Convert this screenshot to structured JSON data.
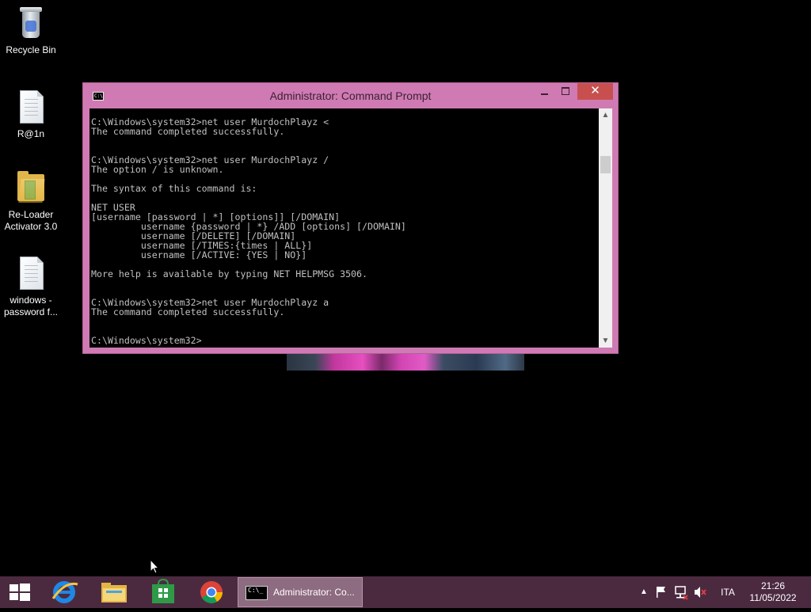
{
  "desktop": {
    "icons": [
      {
        "label": "Recycle Bin",
        "icon": "recycle-bin-icon"
      },
      {
        "label": "R@1n",
        "icon": "document-icon"
      },
      {
        "label": "Re-Loader Activator 3.0",
        "icon": "folder-icon"
      },
      {
        "label": "windows - password f...",
        "icon": "document-icon"
      }
    ]
  },
  "window": {
    "title": "Administrator: Command Prompt",
    "icon_text": "C:\\",
    "close_glyph": "✕",
    "console_text": "C:\\Windows\\system32>net user MurdochPlayz <\nThe command completed successfully.\n\n\nC:\\Windows\\system32>net user MurdochPlayz /\nThe option / is unknown.\n\nThe syntax of this command is:\n\nNET USER\n[username [password | *] [options]] [/DOMAIN]\n         username {password | *} /ADD [options] [/DOMAIN]\n         username [/DELETE] [/DOMAIN]\n         username [/TIMES:{times | ALL}]\n         username [/ACTIVE: {YES | NO}]\n\nMore help is available by typing NET HELPMSG 3506.\n\n\nC:\\Windows\\system32>net user MurdochPlayz a\nThe command completed successfully.\n\n\nC:\\Windows\\system32>",
    "scroll_up": "▲",
    "scroll_down": "▼"
  },
  "taskbar": {
    "pinned": [
      {
        "name": "internet-explorer",
        "icon": "internet-explorer-icon"
      },
      {
        "name": "file-explorer",
        "icon": "file-explorer-icon"
      },
      {
        "name": "store",
        "icon": "store-icon"
      },
      {
        "name": "chrome",
        "icon": "chrome-icon"
      }
    ],
    "active_task_label": "Administrator: Co...",
    "active_task_icon_text": "C:\\_",
    "tray": {
      "show_hidden": "▲",
      "language": "ITA",
      "time": "21:26",
      "date": "11/05/2022"
    }
  },
  "colors": {
    "accent": "#d07ab3",
    "taskbar": "#4b2a40",
    "close": "#c7504f"
  }
}
